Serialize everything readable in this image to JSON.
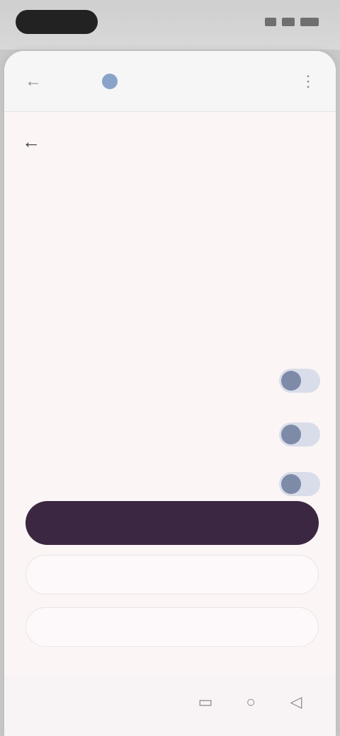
{
  "status_bar": {
    "time": "",
    "icons": [
      "wifi-icon",
      "signal-icon",
      "battery-icon"
    ]
  },
  "browser": {
    "url": "",
    "back_icon": "arrow-left-icon",
    "menu_icon": "more-vertical-icon"
  },
  "page": {
    "back_icon": "arrow-left-icon",
    "header_link": "",
    "heading": "",
    "description": "",
    "more_info": ""
  },
  "toggles": [
    {
      "label": "",
      "state": "on"
    },
    {
      "label": "",
      "state": "on"
    },
    {
      "label": "",
      "state": "on"
    }
  ],
  "buttons": {
    "primary": "",
    "secondary": "",
    "tertiary": ""
  },
  "footer_note": "",
  "colors": {
    "primary_button": "#3c2743",
    "toggle_knob": "#7d8aa8",
    "page_background": "#fbf5f6"
  },
  "nav": {
    "icons": [
      "recents-icon",
      "home-icon",
      "back-icon"
    ]
  }
}
